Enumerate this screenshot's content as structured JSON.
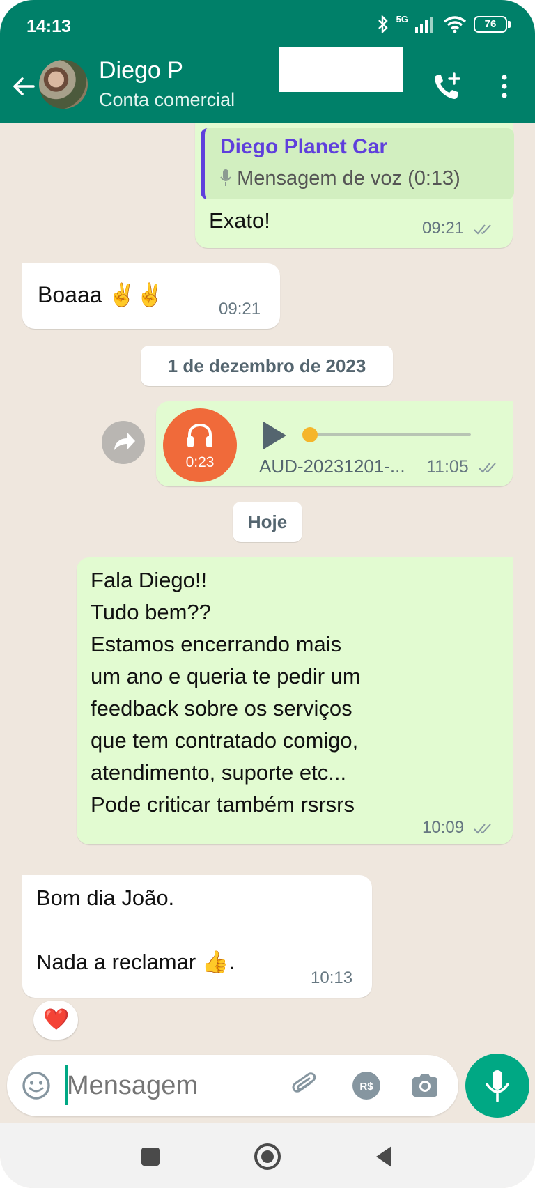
{
  "status_bar": {
    "time": "14:13",
    "network": "5G",
    "battery": "76"
  },
  "header": {
    "contact_name": "Diego P",
    "subtitle": "Conta comercial"
  },
  "messages": {
    "m1": {
      "quote_name": "Diego Planet Car",
      "quote_text": "Mensagem de voz (0:13)",
      "text": "Exato!",
      "time": "09:21"
    },
    "m2": {
      "text": "Boaaa ✌️✌️",
      "time": "09:21"
    },
    "date1": "1 de dezembro de 2023",
    "m3": {
      "duration": "0:23",
      "filename": "AUD-20231201-...",
      "time": "11:05"
    },
    "date2": "Hoje",
    "m4": {
      "text": "Fala Diego!!\nTudo bem??\nEstamos encerrando mais\num ano e queria te pedir um\nfeedback sobre os serviços\nque tem contratado comigo,\natendimento, suporte etc...\nPode criticar também rsrsrs",
      "time": "10:09"
    },
    "m5": {
      "text": "Bom dia João.\n\nNada a reclamar 👍.",
      "time": "10:13",
      "reaction": "❤️"
    }
  },
  "composer": {
    "placeholder": "Mensagem"
  },
  "colors": {
    "header": "#008069",
    "outgoing": "#e2fbd1",
    "incoming": "#ffffff",
    "accent": "#00a884",
    "audio": "#f06a3a"
  },
  "icons": [
    "back-icon",
    "add-call-icon",
    "menu-icon",
    "forward-icon",
    "headphones-icon",
    "play-icon",
    "emoji-icon",
    "attach-icon",
    "payment-icon",
    "camera-icon",
    "mic-icon",
    "nav-recents-icon",
    "nav-home-icon",
    "nav-back-icon"
  ]
}
